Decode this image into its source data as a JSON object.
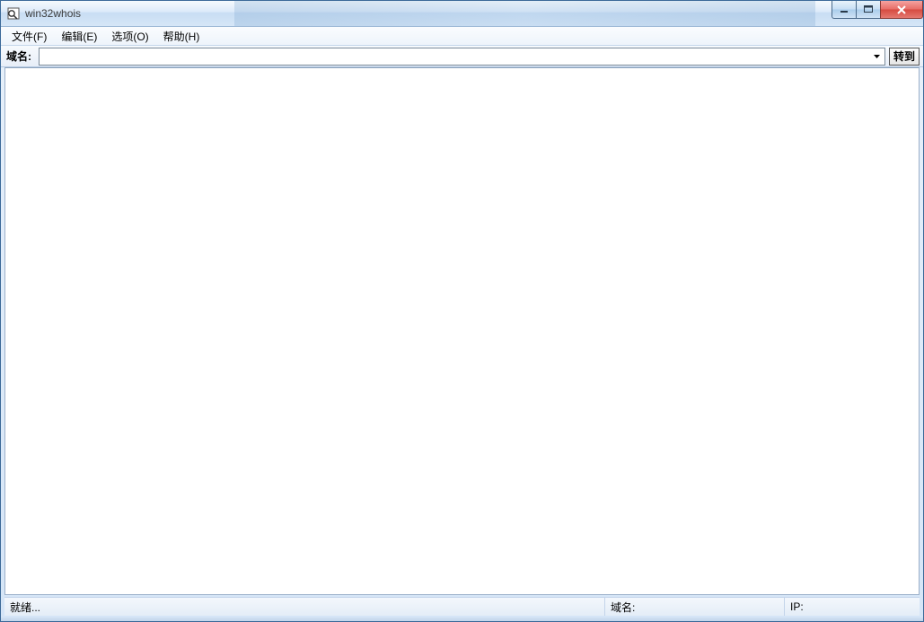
{
  "window": {
    "title": "win32whois"
  },
  "menu": {
    "file": "文件(F)",
    "edit": "编辑(E)",
    "options": "选项(O)",
    "help": "帮助(H)"
  },
  "toolbar": {
    "domain_label": "域名:",
    "domain_value": "",
    "go_label": "转到"
  },
  "status": {
    "ready": "就绪...",
    "domain_label": "域名:",
    "domain_value": "",
    "ip_label": "IP:",
    "ip_value": ""
  }
}
